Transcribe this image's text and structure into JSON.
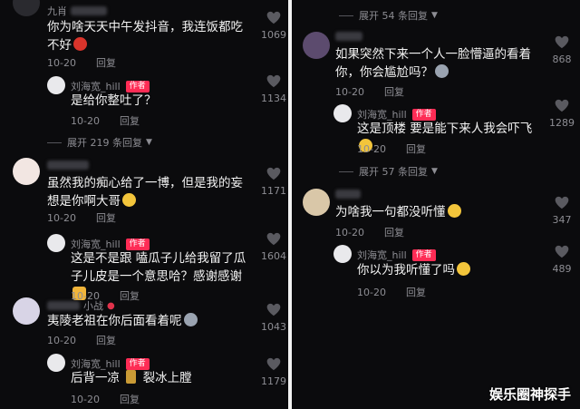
{
  "left": {
    "comments": [
      {
        "user": "九肖",
        "text": "你为啥天天中午发抖音，我连饭都吃不好",
        "date": "10-20",
        "reply": "回复",
        "likes": "1069",
        "emoji": "angry-face-icon"
      },
      {
        "user": "刘海宽_hill",
        "badge": "作者",
        "text": "是给你整吐了？",
        "date": "10-20",
        "reply": "回复",
        "likes": "1134"
      },
      {
        "expand": "展开 219 条回复"
      },
      {
        "user": "",
        "text": "虽然我的痴心给了一博，但是我的妄想是你啊大哥",
        "date": "10-20",
        "reply": "回复",
        "likes": "1171",
        "emoji": "grimace-face-icon"
      },
      {
        "user": "刘海宽_hill",
        "badge": "作者",
        "text": "这是不是跟 嗑瓜子儿给我留了瓜子儿皮是一个意思哈？感谢感谢",
        "date": "10-20",
        "reply": "回复",
        "likes": "1604",
        "emoji": "pray-hands-icon"
      },
      {
        "user": "小战",
        "text": "夷陵老祖在你后面看着呢",
        "date": "10-20",
        "reply": "回复",
        "likes": "1043",
        "emoji": "husky-face-icon"
      },
      {
        "user": "刘海宽_hill",
        "badge": "作者",
        "text": "后背一凉",
        "text2": "裂冰上膛",
        "date": "10-20",
        "reply": "回复",
        "likes": "1179",
        "emoji": "bottle-icon"
      }
    ]
  },
  "right": {
    "comments": [
      {
        "expand": "展开 54 条回复"
      },
      {
        "user": "",
        "text": "如果突然下来一个人一脸懵逼的看着你，你会尴尬吗？",
        "date": "10-20",
        "reply": "回复",
        "likes": "868",
        "emoji": "husky-face-icon"
      },
      {
        "user": "刘海宽_hill",
        "badge": "作者",
        "text": "这是顶楼 要是能下来人我会吓飞",
        "date": "10-20",
        "reply": "回复",
        "likes": "1289",
        "emoji": "laugh-cry-icon"
      },
      {
        "expand": "展开 57 条回复"
      },
      {
        "user": "",
        "text": "为啥我一句都没听懂",
        "date": "10-20",
        "reply": "回复",
        "likes": "347",
        "emoji": "laugh-cry-icon"
      },
      {
        "user": "刘海宽_hill",
        "badge": "作者",
        "text": "你以为我听懂了吗",
        "date": "10-20",
        "reply": "回复",
        "likes": "489",
        "emoji": "shocked-face-icon"
      }
    ]
  },
  "watermark": "娱乐圈神探手",
  "colors": {
    "background": "#0b0b0d",
    "badge": "#fe2c55",
    "meta": "#8d8d93",
    "text": "#f3f3f3"
  }
}
